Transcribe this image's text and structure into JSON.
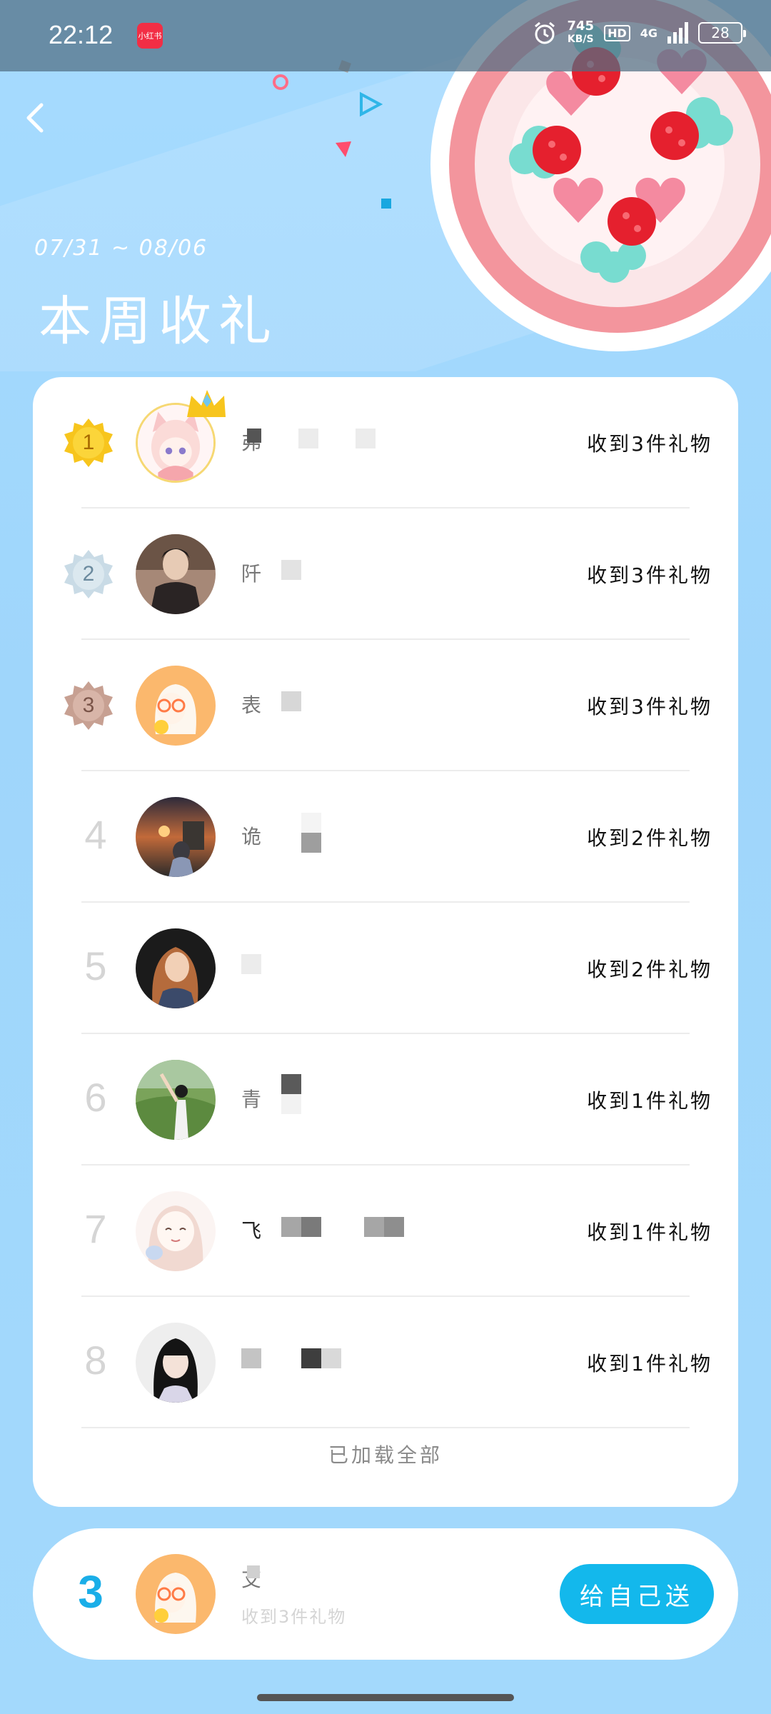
{
  "status_bar": {
    "time": "22:12",
    "app_badge": "小红书",
    "net_speed_value": "745",
    "net_speed_unit": "KB/S",
    "hd": "HD",
    "network": "4G",
    "battery": "28"
  },
  "header": {
    "date_range": "07/31 ~ 08/06",
    "title": "本周收礼"
  },
  "ranking": [
    {
      "rank": "1",
      "name_char": "弗",
      "gift_text": "收到3件礼物"
    },
    {
      "rank": "2",
      "name_char": "阡",
      "gift_text": "收到3件礼物"
    },
    {
      "rank": "3",
      "name_char": "表",
      "gift_text": "收到3件礼物"
    },
    {
      "rank": "4",
      "name_char": "诡",
      "gift_text": "收到2件礼物"
    },
    {
      "rank": "5",
      "name_char": "",
      "gift_text": "收到2件礼物"
    },
    {
      "rank": "6",
      "name_char": "青",
      "gift_text": "收到1件礼物"
    },
    {
      "rank": "7",
      "name_char": "飞",
      "gift_text": "收到1件礼物"
    },
    {
      "rank": "8",
      "name_char": "",
      "gift_text": "收到1件礼物"
    }
  ],
  "load_all": "已加载全部",
  "my_entry": {
    "rank": "3",
    "name_char": "艾",
    "gift_text": "收到3件礼物",
    "button_label": "给自己送"
  },
  "colors": {
    "accent": "#13b8ec",
    "background": "#a6dbff",
    "gold": "#f7c51d",
    "silver": "#c9dbe6",
    "bronze": "#c7a092"
  }
}
